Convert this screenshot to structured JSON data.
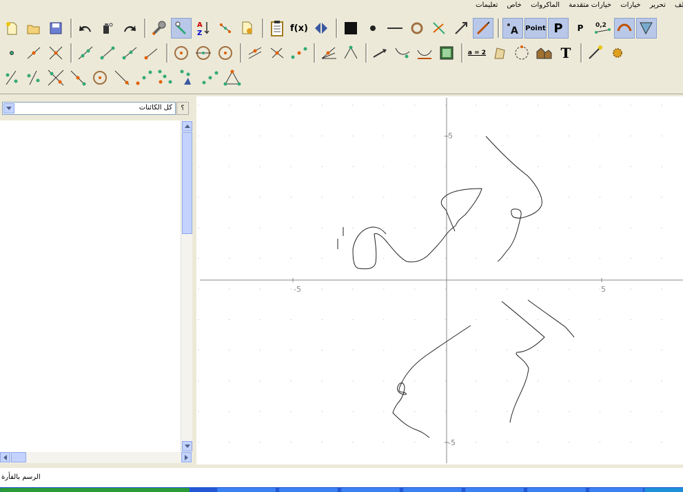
{
  "menu": {
    "items": [
      "ملف",
      "تحرير",
      "خيارات",
      "خيارات متقدمة",
      "الماكروات",
      "خاص",
      "تعليمات"
    ]
  },
  "toolbar": {
    "fx_label": "f(x)",
    "point_label": "Point",
    "big_p_label": "P",
    "small_p_label": "P",
    "num_label": "0,2",
    "eq_label": "a = 2",
    "text_tool_label": "T",
    "sort_label_a": "A",
    "sort_label_z": "Z"
  },
  "objects_panel": {
    "combo_value": "كل الكائنات",
    "help_label": "؟"
  },
  "canvas": {
    "x_tick_neg": "-5",
    "x_tick_pos": "5",
    "y_tick_pos": "5",
    "y_tick_neg": "-5"
  },
  "status": {
    "text": "الرسم بالفأرة"
  },
  "colors": {
    "window_bg": "#ece9d8",
    "scroll_blue": "#c3d3fd",
    "taskbar_blue": "#2457d6",
    "axis_gray": "#888888"
  }
}
